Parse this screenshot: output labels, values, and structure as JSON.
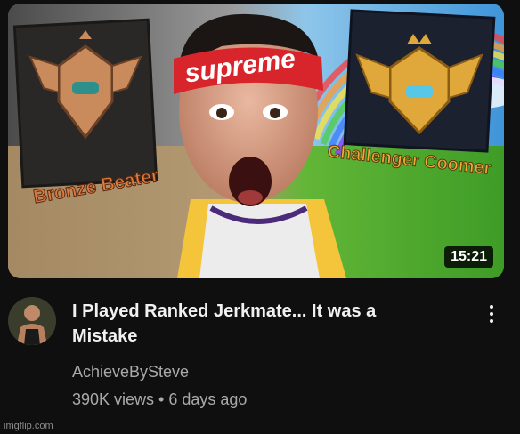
{
  "video": {
    "title": "I Played Ranked Jerkmate... It was a Mistake",
    "channel": "AchieveBySteve",
    "meta": "390K views • 6 days ago",
    "duration": "15:21"
  },
  "thumbnail": {
    "left_badge_label": "Bronze Beater",
    "right_badge_label": "Challenger Coomer",
    "headband_text": "supreme"
  },
  "watermark": "imgflip.com",
  "icons": {
    "menu": "more-vert-icon"
  },
  "colors": {
    "background": "#0f0f0f",
    "title": "#f1f1f1",
    "secondary_text": "#aaaaaa",
    "headband": "#d8242b",
    "bronze": "#c98a5c",
    "gold": "#e0a83a"
  }
}
